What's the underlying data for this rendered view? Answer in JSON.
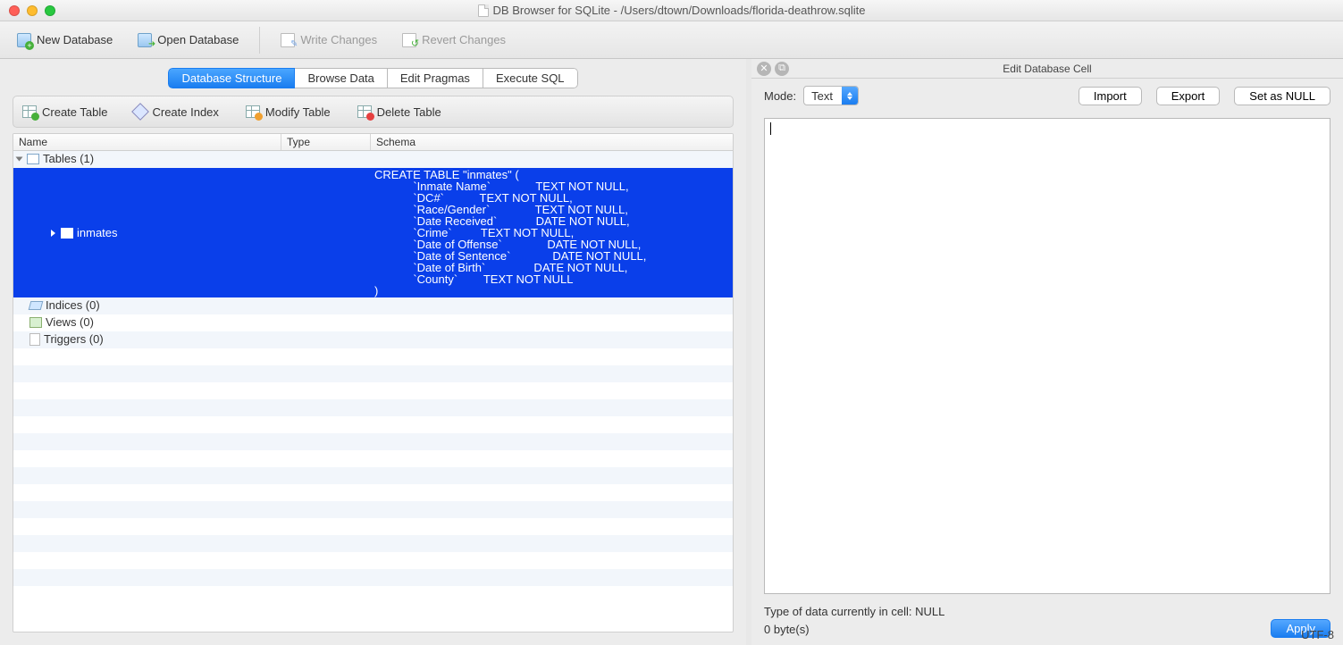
{
  "window": {
    "title": "DB Browser for SQLite - /Users/dtown/Downloads/florida-deathrow.sqlite"
  },
  "toolbar": {
    "new_db": "New Database",
    "open_db": "Open Database",
    "write_changes": "Write Changes",
    "revert_changes": "Revert Changes"
  },
  "tabs": {
    "structure": "Database Structure",
    "browse": "Browse Data",
    "pragmas": "Edit Pragmas",
    "sql": "Execute SQL"
  },
  "subtoolbar": {
    "create_table": "Create Table",
    "create_index": "Create Index",
    "modify_table": "Modify Table",
    "delete_table": "Delete Table"
  },
  "tree": {
    "headers": {
      "name": "Name",
      "type": "Type",
      "schema": "Schema"
    },
    "tables_label": "Tables (1)",
    "table_name": "inmates",
    "table_schema": "CREATE TABLE \"inmates\" (\n            `Inmate Name`              TEXT NOT NULL,\n            `DC#`           TEXT NOT NULL,\n            `Race/Gender`              TEXT NOT NULL,\n            `Date Received`            DATE NOT NULL,\n            `Crime`         TEXT NOT NULL,\n            `Date of Offense`              DATE NOT NULL,\n            `Date of Sentence`             DATE NOT NULL,\n            `Date of Birth`               DATE NOT NULL,\n            `County`        TEXT NOT NULL\n)",
    "indices_label": "Indices (0)",
    "views_label": "Views (0)",
    "triggers_label": "Triggers (0)"
  },
  "cell_editor": {
    "title": "Edit Database Cell",
    "mode_label": "Mode:",
    "mode_value": "Text",
    "import": "Import",
    "export": "Export",
    "set_null": "Set as NULL",
    "type_line": "Type of data currently in cell: NULL",
    "size_line": "0 byte(s)",
    "apply": "Apply",
    "encoding": "UTF-8"
  }
}
